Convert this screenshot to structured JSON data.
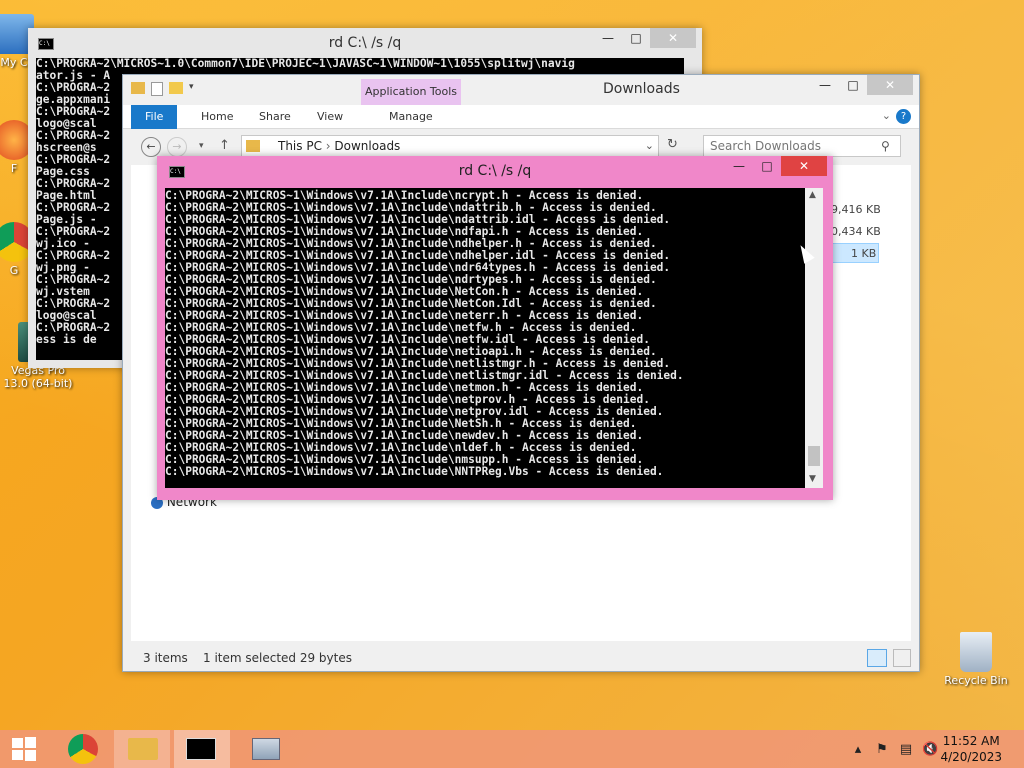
{
  "desktop": {
    "icons": [
      {
        "label": "My C",
        "name": "my-computer"
      },
      {
        "label": "F",
        "name": "firefox"
      },
      {
        "label": "G",
        "name": "chrome-shortcut"
      },
      {
        "label": "Vegas Pro 13.0 (64-bit)",
        "name": "vegas-pro"
      },
      {
        "label": "Recycle Bin",
        "name": "recycle-bin"
      }
    ]
  },
  "cmd_back": {
    "title": "rd  C:\\ /s /q",
    "lines": [
      "C:\\PROGRA~2\\MICROS~1.0\\Common7\\IDE\\PROJEC~1\\JAVASC~1\\WINDOW~1\\1055\\splitwj\\navig",
      "ator.js - A",
      "C:\\PROGRA~2",
      "ge.appxmani",
      "C:\\PROGRA~2",
      "logo@scal",
      "C:\\PROGRA~2",
      "hscreen@s",
      "C:\\PROGRA~2",
      "Page.css",
      "C:\\PROGRA~2",
      "Page.html",
      "C:\\PROGRA~2",
      "Page.js -",
      "C:\\PROGRA~2",
      "wj.ico -",
      "C:\\PROGRA~2",
      "wj.png -",
      "C:\\PROGRA~2",
      "wj.vstem",
      "C:\\PROGRA~2",
      "logo@scal",
      "C:\\PROGRA~2",
      "ess is de"
    ]
  },
  "explorer": {
    "title": "Downloads",
    "context_tab": "Application Tools",
    "tabs": [
      "File",
      "Home",
      "Share",
      "View",
      "Manage"
    ],
    "breadcrumb": [
      "This PC",
      "Downloads"
    ],
    "search_placeholder": "Search Downloads",
    "sizes": [
      "9,416 KB",
      "0,434 KB",
      "1 KB"
    ],
    "nav_network": "Network",
    "status_items": "3 items",
    "status_selected": "1 item selected  29 bytes"
  },
  "cmd_front": {
    "title": "rd  C:\\ /s /q",
    "lines": [
      "C:\\PROGRA~2\\MICROS~1\\Windows\\v7.1A\\Include\\ncrypt.h - Access is denied.",
      "C:\\PROGRA~2\\MICROS~1\\Windows\\v7.1A\\Include\\ndattrib.h - Access is denied.",
      "C:\\PROGRA~2\\MICROS~1\\Windows\\v7.1A\\Include\\ndattrib.idl - Access is denied.",
      "C:\\PROGRA~2\\MICROS~1\\Windows\\v7.1A\\Include\\ndfapi.h - Access is denied.",
      "C:\\PROGRA~2\\MICROS~1\\Windows\\v7.1A\\Include\\ndhelper.h - Access is denied.",
      "C:\\PROGRA~2\\MICROS~1\\Windows\\v7.1A\\Include\\ndhelper.idl - Access is denied.",
      "C:\\PROGRA~2\\MICROS~1\\Windows\\v7.1A\\Include\\ndr64types.h - Access is denied.",
      "C:\\PROGRA~2\\MICROS~1\\Windows\\v7.1A\\Include\\ndrtypes.h - Access is denied.",
      "C:\\PROGRA~2\\MICROS~1\\Windows\\v7.1A\\Include\\NetCon.h - Access is denied.",
      "C:\\PROGRA~2\\MICROS~1\\Windows\\v7.1A\\Include\\NetCon.Idl - Access is denied.",
      "C:\\PROGRA~2\\MICROS~1\\Windows\\v7.1A\\Include\\neterr.h - Access is denied.",
      "C:\\PROGRA~2\\MICROS~1\\Windows\\v7.1A\\Include\\netfw.h - Access is denied.",
      "C:\\PROGRA~2\\MICROS~1\\Windows\\v7.1A\\Include\\netfw.idl - Access is denied.",
      "C:\\PROGRA~2\\MICROS~1\\Windows\\v7.1A\\Include\\netioapi.h - Access is denied.",
      "C:\\PROGRA~2\\MICROS~1\\Windows\\v7.1A\\Include\\netlistmgr.h - Access is denied.",
      "C:\\PROGRA~2\\MICROS~1\\Windows\\v7.1A\\Include\\netlistmgr.idl - Access is denied.",
      "C:\\PROGRA~2\\MICROS~1\\Windows\\v7.1A\\Include\\netmon.h - Access is denied.",
      "C:\\PROGRA~2\\MICROS~1\\Windows\\v7.1A\\Include\\netprov.h - Access is denied.",
      "C:\\PROGRA~2\\MICROS~1\\Windows\\v7.1A\\Include\\netprov.idl - Access is denied.",
      "C:\\PROGRA~2\\MICROS~1\\Windows\\v7.1A\\Include\\NetSh.h - Access is denied.",
      "C:\\PROGRA~2\\MICROS~1\\Windows\\v7.1A\\Include\\newdev.h - Access is denied.",
      "C:\\PROGRA~2\\MICROS~1\\Windows\\v7.1A\\Include\\nldef.h - Access is denied.",
      "C:\\PROGRA~2\\MICROS~1\\Windows\\v7.1A\\Include\\nmsupp.h - Access is denied.",
      "C:\\PROGRA~2\\MICROS~1\\Windows\\v7.1A\\Include\\NNTPReg.Vbs - Access is denied."
    ]
  },
  "taskbar": {
    "time": "11:52 AM",
    "date": "4/20/2023"
  },
  "colors": {
    "accent": "#1979ca",
    "console_frame": "#f087c9",
    "close_red": "#e04343"
  }
}
